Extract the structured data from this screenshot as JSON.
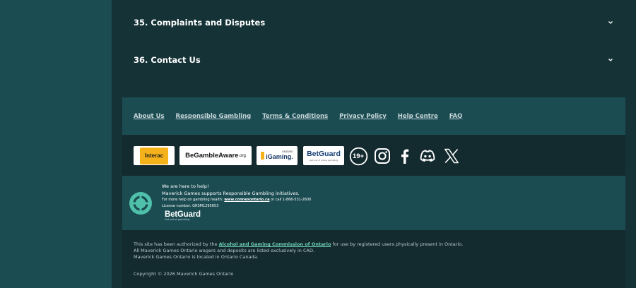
{
  "accordion": [
    {
      "title": "35. Complaints and Disputes"
    },
    {
      "title": "36. Contact Us"
    }
  ],
  "footer_links": [
    "About Us",
    "Responsible Gambling",
    "Terms & Conditions",
    "Privacy Policy",
    "Help Centre",
    "FAQ"
  ],
  "partner_logos": {
    "interac": "Interac",
    "begambleaware_prefix": "BeGambleAware",
    "begambleaware_suffix": ".org",
    "igaming_brand": "iGaming.",
    "igaming_top": "ONTARIO",
    "betguard_main": "BetGuard",
    "betguard_sub": "Get out of online gambling",
    "age": "19+"
  },
  "social_icons": [
    "instagram-icon",
    "facebook-icon",
    "discord-icon",
    "x-icon"
  ],
  "responsible": {
    "line1": "We are here to help!",
    "line2": "Maverick Games supports Responsible Gambling initiatives.",
    "help_prefix": "For more help on gambling health:",
    "help_link": "www.connexontario.ca",
    "help_suffix": "or call 1-866-531-2600",
    "license": "License number: GRSM1295653",
    "betguard": "BetGuard",
    "betguard_sub": "Get out of gambling"
  },
  "legal": {
    "auth_prefix": "This site has been authorized by the",
    "auth_link": "Alcohol and Gaming Commission of Ontario",
    "auth_suffix": "for use by registered users physically present in Ontario.",
    "line2": "All Maverick Games Ontario wagers and deposits are listed exclusively in CAD.",
    "line3": "Maverick Games Ontario is located in Ontario Canada.",
    "copyright": "Copyright © 2026 Maverick Games Ontario"
  },
  "colors": {
    "sidebar": "#1b4c52",
    "main_bg": "#153237",
    "footer_light": "#1b4c52",
    "footer_dark": "#132a2e",
    "accent": "#6fd0b5",
    "interac_yellow": "#f6b21b"
  }
}
